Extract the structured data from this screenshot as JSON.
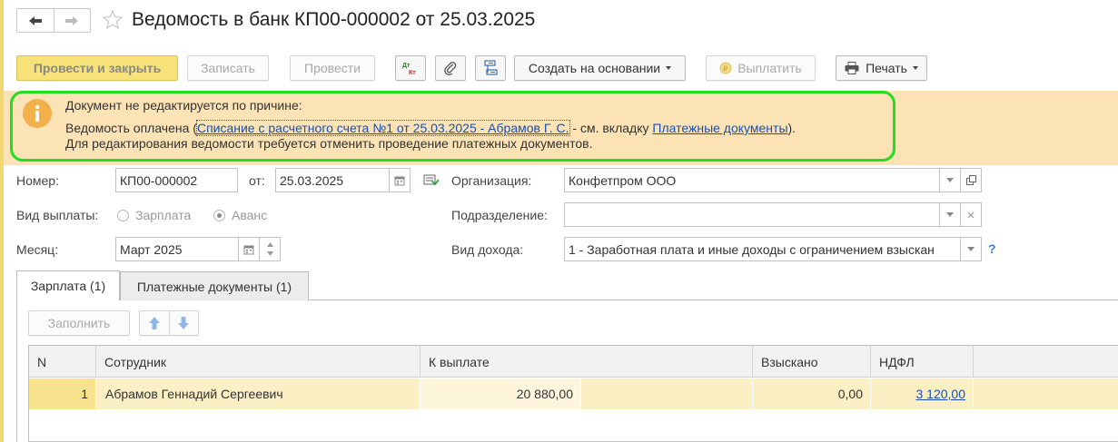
{
  "window": {
    "title": "Ведомость в банк КП00-000002 от 25.03.2025"
  },
  "toolbar": {
    "post_close": "Провести и закрыть",
    "save": "Записать",
    "post": "Провести",
    "create_based": "Создать на основании",
    "pay": "Выплатить",
    "print": "Печать"
  },
  "info": {
    "line1": "Документ не редактируется по причине:",
    "line2_prefix": "Ведомость оплачена (",
    "line2_link": "Списание с расчетного счета №1 от 25.03.2025 - Абрамов Г. С.",
    "line2_mid": " - см. вкладку ",
    "line2_link2": "Платежные документы",
    "line2_suffix": ").",
    "line3": "Для редактирования ведомости требуется отменить проведение платежных документов."
  },
  "form": {
    "number_label": "Номер:",
    "number_value": "КП00-000002",
    "date_label": "от:",
    "date_value": "25.03.2025",
    "org_label": "Организация:",
    "org_value": "Конфетпром ООО",
    "paytype_label": "Вид выплаты:",
    "paytype_options": [
      "Зарплата",
      "Аванс"
    ],
    "dept_label": "Подразделение:",
    "dept_value": "",
    "month_label": "Месяц:",
    "month_value": "Март 2025",
    "income_label": "Вид дохода:",
    "income_value": "1 - Заработная плата и иные доходы с ограничением взыскан",
    "help": "?"
  },
  "tabs": [
    {
      "label": "Зарплата (1)"
    },
    {
      "label": "Платежные документы (1)"
    }
  ],
  "table_toolbar": {
    "fill": "Заполнить"
  },
  "table": {
    "columns": [
      "N",
      "Сотрудник",
      "К выплате",
      "Взыскано",
      "НДФЛ"
    ],
    "rows": [
      {
        "n": "1",
        "employee": "Абрамов Геннадий Сергеевич",
        "to_pay": "20 880,00",
        "recovered": "0,00",
        "ndfl": "3 120,00"
      }
    ]
  },
  "colors": {
    "accent_yellow": "#f7e27a",
    "highlight_green": "#22dd22",
    "info_bg": "#fbe3b6",
    "link": "#1a4fb0"
  }
}
